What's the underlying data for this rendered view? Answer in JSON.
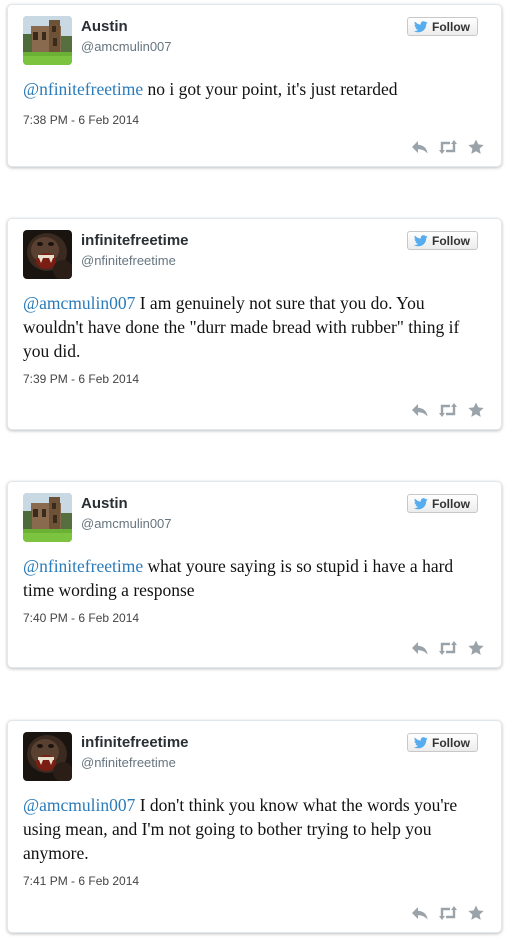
{
  "follow_label": "Follow",
  "icons": {
    "follow": "twitter-bird-icon",
    "reply": "reply-icon",
    "retweet": "retweet-icon",
    "favorite": "star-icon"
  },
  "colors": {
    "mention": "#2b7bb9",
    "bird": "#55acee",
    "action_icon": "#9aa3a9"
  },
  "tweets": [
    {
      "name": "Austin",
      "handle": "@amcmulin007",
      "mention": "@nfinitefreetime",
      "text": " no i got your point, it's just retarded",
      "time": "7:38 PM - 6 Feb 2014"
    },
    {
      "name": "infinitefreetime",
      "handle": "@nfinitefreetime",
      "mention": "@amcmulin007",
      "text": " I am genuinely not sure that you do. You wouldn't have done the \"durr made bread with rubber\" thing if you did.",
      "time": "7:39 PM - 6 Feb 2014"
    },
    {
      "name": "Austin",
      "handle": "@amcmulin007",
      "mention": "@nfinitefreetime",
      "text": " what youre saying is so stupid i have a hard time wording a response",
      "time": "7:40 PM - 6 Feb 2014"
    },
    {
      "name": "infinitefreetime",
      "handle": "@nfinitefreetime",
      "mention": "@amcmulin007",
      "text": " I don't think you know what the words you're using mean, and I'm not going to bother trying to help you anymore.",
      "time": "7:41 PM - 6 Feb 2014"
    }
  ]
}
